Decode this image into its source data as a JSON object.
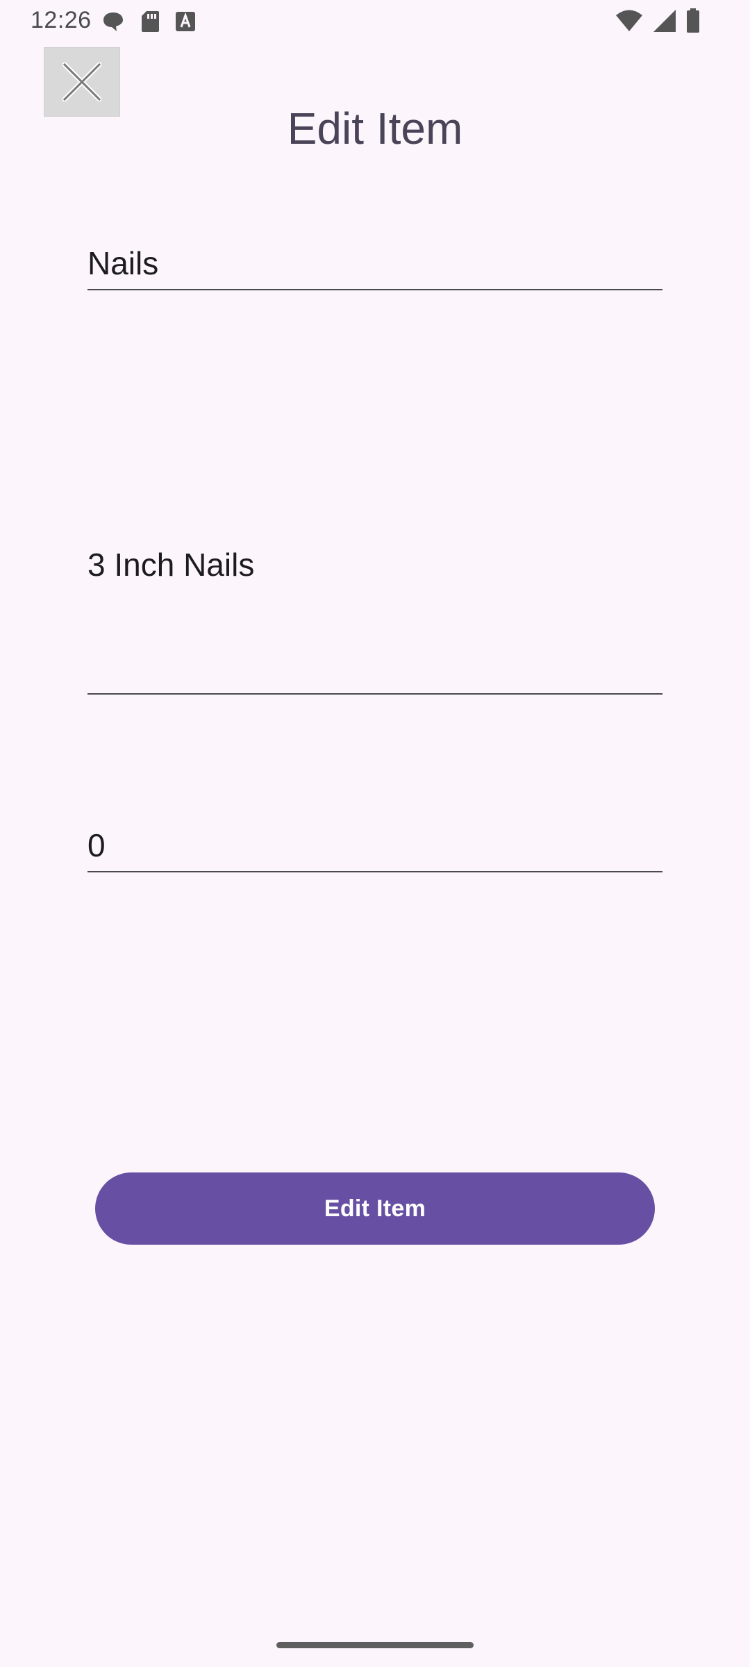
{
  "status_bar": {
    "time": "12:26",
    "left_icons": [
      "chat-bubble-icon",
      "sd-card-icon",
      "font-a-icon"
    ],
    "right_icons": [
      "wifi-icon",
      "cell-signal-icon",
      "battery-icon"
    ]
  },
  "header": {
    "close_icon": "close-icon",
    "title": "Edit Item"
  },
  "form": {
    "name_value": "Nails",
    "description_value": "3 Inch Nails",
    "quantity_value": "0"
  },
  "actions": {
    "submit_label": "Edit Item"
  },
  "colors": {
    "background": "#FCF5FC",
    "primary": "#6750A4",
    "title_text": "#4A4458",
    "close_button_bg": "#D9D9D9"
  }
}
